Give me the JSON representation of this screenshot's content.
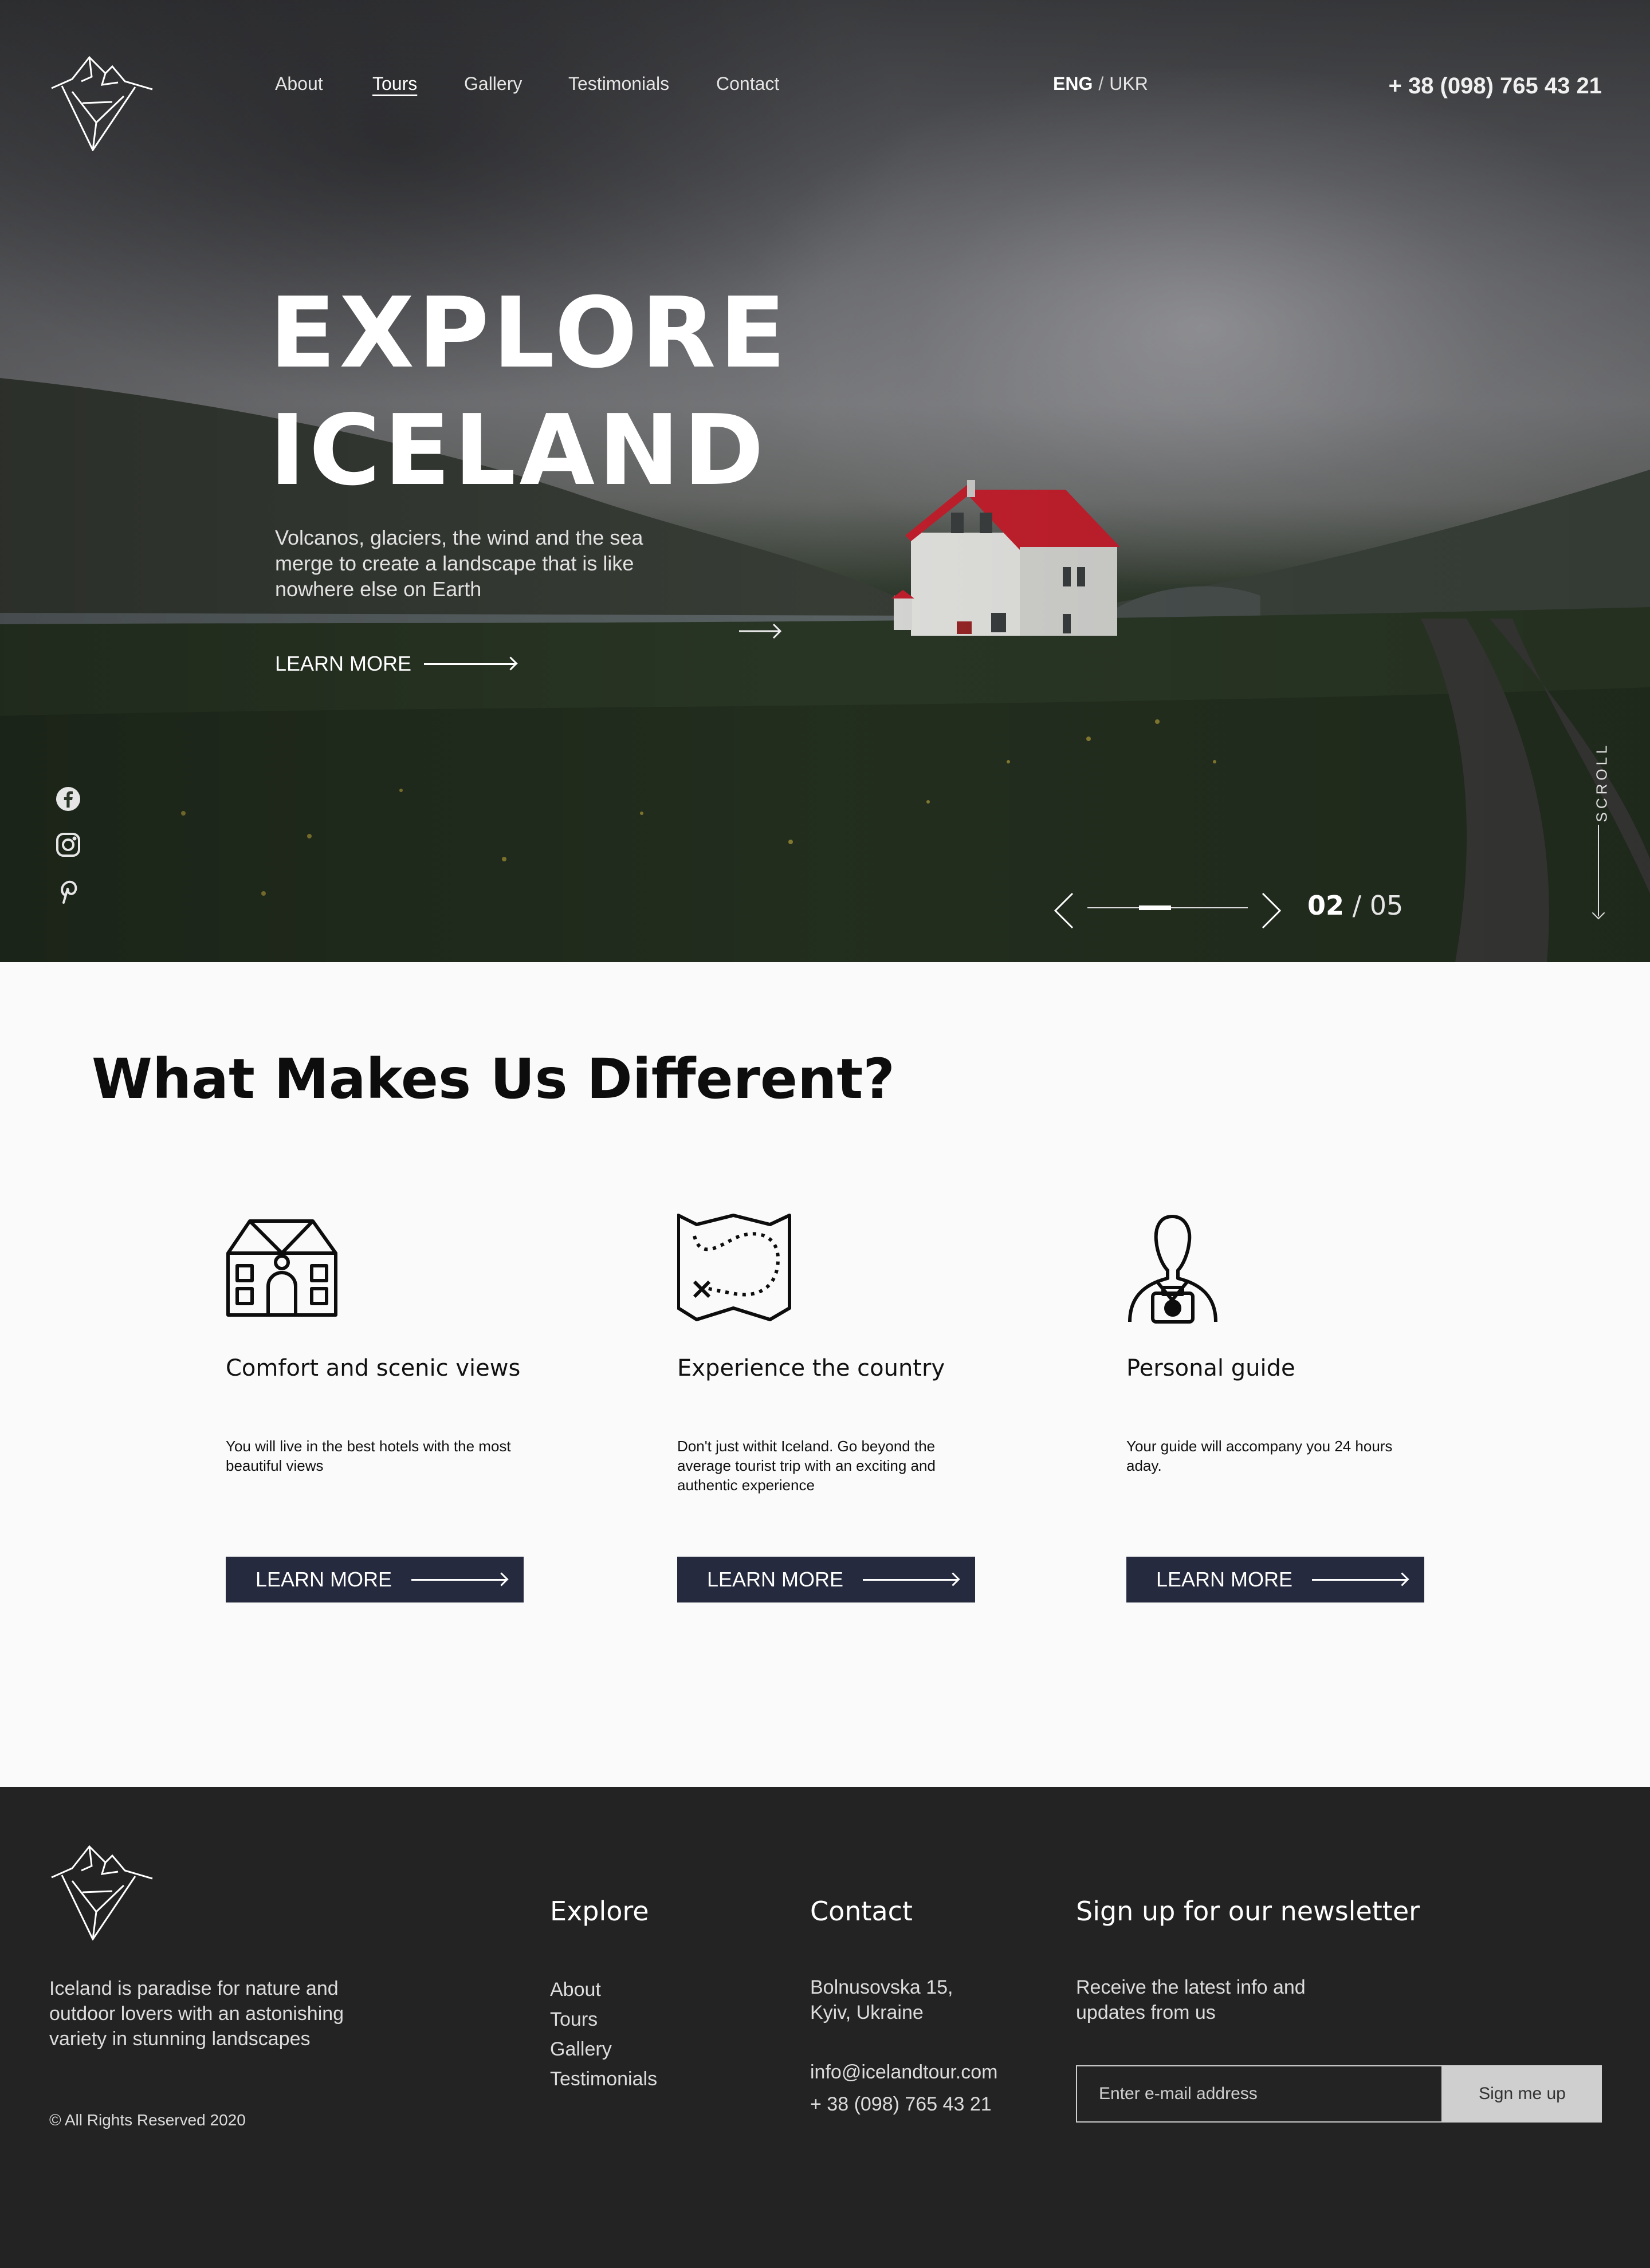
{
  "header": {
    "logo_icon": "iceberg-mountain-logo",
    "nav": [
      {
        "label": "About",
        "active": false
      },
      {
        "label": "Tours",
        "active": true
      },
      {
        "label": "Gallery",
        "active": false
      },
      {
        "label": "Testimonials",
        "active": false
      },
      {
        "label": "Contact",
        "active": false
      }
    ],
    "lang": {
      "current": "ENG",
      "separator": "/",
      "other": "UKR"
    },
    "phone": "+ 38 (098) 765 43 21"
  },
  "hero": {
    "title_line1": "EXPLORE",
    "title_line2": "ICELAND",
    "subtitle": "Volcanos, glaciers, the wind and the sea merge to create a landscape that is like nowhere else on Earth",
    "cta": "LEARN MORE",
    "socials": [
      "facebook-icon",
      "instagram-icon",
      "pinterest-icon"
    ],
    "scroll_label": "SCROLL",
    "slider": {
      "current": "02",
      "separator": "/",
      "total": "05",
      "progress": 0.4
    }
  },
  "features": {
    "title": "What Makes Us Different?",
    "cards": [
      {
        "icon": "house-icon",
        "title": "Comfort and scenic views",
        "text": "You will live in the best hotels with the most beautiful views",
        "cta": "LEARN MORE"
      },
      {
        "icon": "treasure-map-icon",
        "title": "Experience the country",
        "text": "Don't just withit Iceland. Go beyond the average tourist trip with an exciting and authentic experience",
        "cta": "LEARN MORE"
      },
      {
        "icon": "photographer-guide-icon",
        "title": "Personal guide",
        "text": "Your guide will accompany you 24 hours aday.",
        "cta": "LEARN MORE"
      }
    ]
  },
  "footer": {
    "about": "Iceland is paradise for nature and outdoor lovers with an astonishing variety in stunning landscapes",
    "copyright": "© All Rights Reserved 2020",
    "explore": {
      "title": "Explore",
      "links": [
        "About",
        "Tours",
        "Gallery",
        "Testimonials"
      ]
    },
    "contact": {
      "title": "Contact",
      "address_line1": "Bolnusovska 15,",
      "address_line2": "Kyiv, Ukraine",
      "email": "info@icelandtour.com",
      "phone": "+ 38 (098) 765 43 21"
    },
    "newsletter": {
      "title": "Sign up for our newsletter",
      "text": "Receive the latest info and updates from us",
      "placeholder": "Enter e-mail address",
      "button": "Sign me up"
    }
  },
  "colors": {
    "accent_button": "#252a3e",
    "footer_bg": "#232323",
    "page_bg": "#fafafa",
    "roof": "#c8202e"
  }
}
